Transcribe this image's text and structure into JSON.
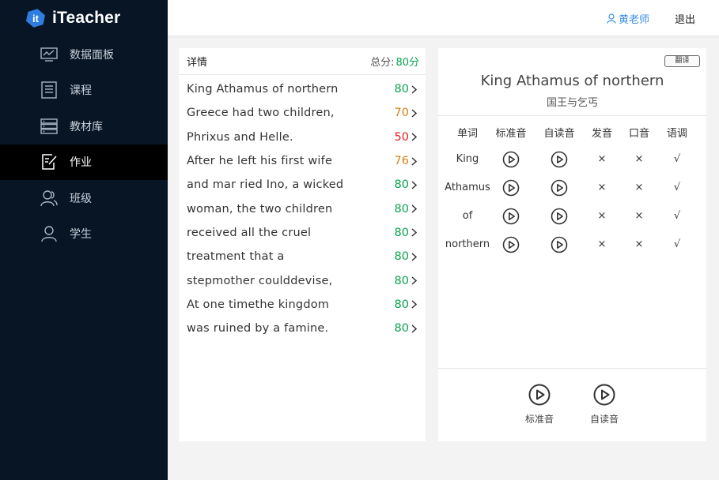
{
  "app": {
    "name": "iTeacher",
    "logo_glyph": "it"
  },
  "sidebar": {
    "items": [
      {
        "label": "数据面板",
        "icon": "dashboard-icon",
        "active": false
      },
      {
        "label": "课程",
        "icon": "course-list-icon",
        "active": false
      },
      {
        "label": "教材库",
        "icon": "library-icon",
        "active": false
      },
      {
        "label": "作业",
        "icon": "homework-icon",
        "active": true
      },
      {
        "label": "班级",
        "icon": "class-group-icon",
        "active": false
      },
      {
        "label": "学生",
        "icon": "student-icon",
        "active": false
      }
    ]
  },
  "header": {
    "user_name": "黄老师",
    "logout_label": "退出"
  },
  "detail": {
    "title": "详情",
    "total_label": "总分:",
    "total_value": "80分",
    "rows": [
      {
        "text": "King Athamus of northern",
        "score": "80",
        "color": "#0aa34f"
      },
      {
        "text": "Greece had two children,",
        "score": "70",
        "color": "#d4820e"
      },
      {
        "text": "Phrixus and Helle.",
        "score": "50",
        "color": "#e02020"
      },
      {
        "text": "After he left his first wife",
        "score": "76",
        "color": "#d4820e"
      },
      {
        "text": "and mar ried Ino, a wicked",
        "score": "80",
        "color": "#0aa34f"
      },
      {
        "text": "woman, the two children",
        "score": "80",
        "color": "#0aa34f"
      },
      {
        "text": "received all the cruel",
        "score": "80",
        "color": "#0aa34f"
      },
      {
        "text": "treatment that a",
        "score": "80",
        "color": "#0aa34f"
      },
      {
        "text": "stepmother coulddevise,",
        "score": "80",
        "color": "#0aa34f"
      },
      {
        "text": "At one timethe kingdom",
        "score": "80",
        "color": "#0aa34f"
      },
      {
        "text": "was ruined by a famine.",
        "score": "80",
        "color": "#0aa34f"
      }
    ]
  },
  "word_panel": {
    "translate_button": "翻译",
    "sentence": "King Athamus of northern",
    "translation": "国王与乞丐",
    "columns": [
      "单词",
      "标准音",
      "自读音",
      "发音",
      "口音",
      "语调"
    ],
    "words": [
      {
        "word": "King",
        "pronunciation": "×",
        "accent": "×",
        "intonation": "√"
      },
      {
        "word": "Athamus",
        "pronunciation": "×",
        "accent": "×",
        "intonation": "√"
      },
      {
        "word": "of",
        "pronunciation": "×",
        "accent": "×",
        "intonation": "√"
      },
      {
        "word": "northern",
        "pronunciation": "×",
        "accent": "×",
        "intonation": "√"
      }
    ],
    "bottom_buttons": [
      {
        "label": "标准音",
        "icon": "play-icon"
      },
      {
        "label": "自读音",
        "icon": "play-icon"
      }
    ]
  },
  "colors": {
    "sidebar_bg": "#071525",
    "active_bg": "#000000",
    "accent_blue": "#3a8ee6",
    "good_green": "#0aa34f",
    "warn_orange": "#d4820e",
    "bad_red": "#e02020"
  }
}
